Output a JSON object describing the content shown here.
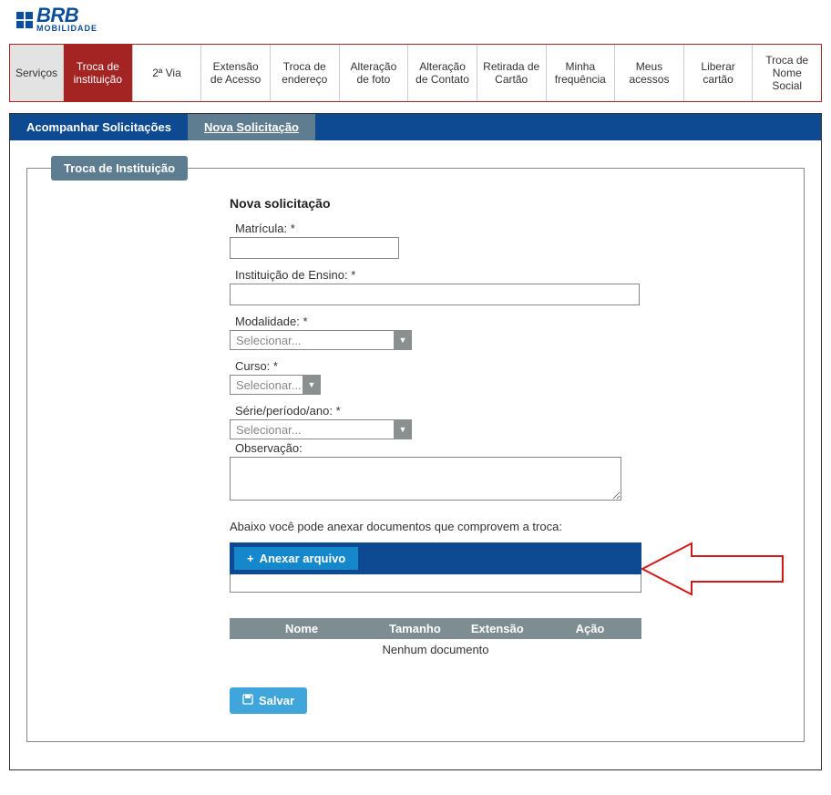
{
  "brand": {
    "name": "BRB",
    "sub": "MOBILIDADE"
  },
  "nav": {
    "items": [
      {
        "label": "Serviços"
      },
      {
        "label": "Troca de instituição"
      },
      {
        "label": "2ª Via"
      },
      {
        "label": "Extensão de Acesso"
      },
      {
        "label": "Troca de endereço"
      },
      {
        "label": "Alteração de foto"
      },
      {
        "label": "Alteração de Contato"
      },
      {
        "label": "Retirada de Cartão"
      },
      {
        "label": "Minha frequência"
      },
      {
        "label": "Meus acessos"
      },
      {
        "label": "Liberar cartão"
      },
      {
        "label": "Troca de Nome Social"
      }
    ]
  },
  "tabs": {
    "follow": "Acompanhar Solicitações",
    "new": "Nova Solicitação"
  },
  "legend": "Troca de Instituição",
  "form": {
    "title": "Nova solicitação",
    "matricula_label": "Matrícula:",
    "instituicao_label": "Instituição de Ensino:",
    "modalidade_label": "Modalidade:",
    "curso_label": "Curso:",
    "serie_label": "Série/período/ano:",
    "observacao_label": "Observação:",
    "select_placeholder": "Selecionar...",
    "attach_caption": "Abaixo você pode anexar documentos que comprovem a troca:",
    "attach_button": "Anexar arquivo",
    "table": {
      "nome": "Nome",
      "tamanho": "Tamanho",
      "extensao": "Extensão",
      "acao": "Ação",
      "empty": "Nenhum documento"
    },
    "save_button": "Salvar"
  }
}
